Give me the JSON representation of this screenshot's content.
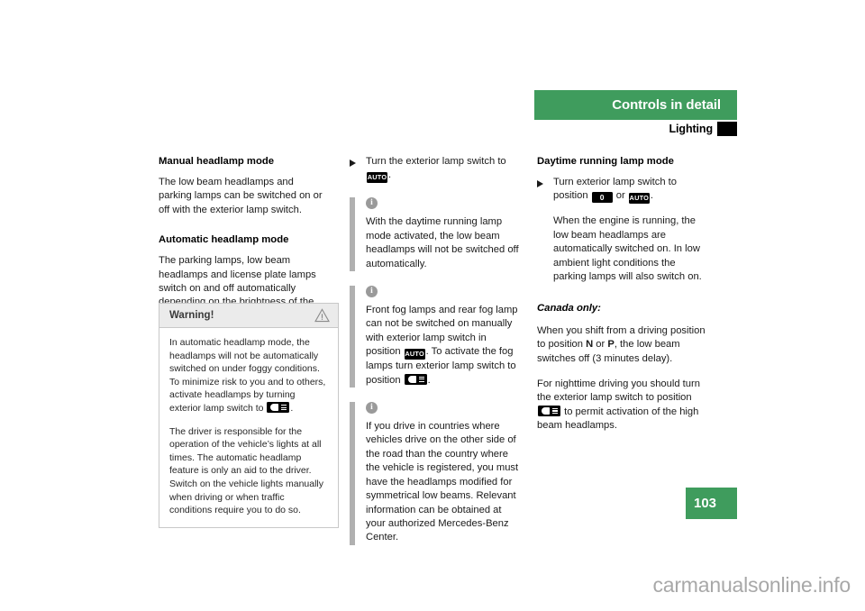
{
  "header": {
    "section_title": "Controls in detail",
    "subsection_title": "Lighting"
  },
  "page_number": "103",
  "watermark": "carmanualsonline.info",
  "symbols": {
    "auto_label": "AUTO",
    "zero_label": "0",
    "lowbeam_name": "low-beam-headlamp-symbol"
  },
  "left_column": {
    "heading1": "Manual headlamp mode",
    "para1": "The low beam headlamps and parking lamps can be switched on or off with the exterior lamp switch.",
    "heading2": "Automatic headlamp mode",
    "para2": "The parking lamps, low beam headlamps and license plate lamps switch on and off automatically depending on the brightness of the ambient light.",
    "warning": {
      "title": "Warning!",
      "body1_a": "In automatic headlamp mode, the headlamps will not be automatically switched on under foggy conditions. To minimize risk to you and to others, activate headlamps by turning exterior lamp switch to ",
      "body1_b": ".",
      "body2": "The driver is responsible for the operation of the vehicle’s lights at all times. The automatic headlamp feature is only an aid to the driver. Switch on the vehicle lights manually when driving or when traffic conditions require you to do so."
    }
  },
  "middle_column": {
    "bullet1_a": "Turn the exterior lamp switch to ",
    "bullet1_b": ".",
    "note1": "With the daytime running lamp mode activated, the low beam headlamps will not be switched off automatically.",
    "note2_a": "Front fog lamps and rear fog lamp can not be switched on manually with exterior lamp switch in position ",
    "note2_b": ". To activate the fog lamps turn exterior lamp switch to position ",
    "note2_c": ".",
    "note3": "If you drive in countries where vehicles drive on the other side of the road than the country where the vehicle is registered, you must have the headlamps modified for symmetrical low beams. Relevant information can be obtained at your authorized Mercedes-Benz Center."
  },
  "right_column": {
    "heading1": "Daytime running lamp mode",
    "bullet1_a": "Turn exterior lamp switch to position ",
    "bullet1_or": " or ",
    "bullet1_b": ".",
    "bullet1_para2": "When the engine is running, the low beam headlamps are automatically switched on. In low ambient light conditions the parking lamps will also switch on.",
    "canada_heading": "Canada only:",
    "canada_para1_a": "When you shift from a driving position to position ",
    "canada_para1_n": "N",
    "canada_para1_or": " or ",
    "canada_para1_p": "P",
    "canada_para1_b": ", the low beam switches off (3 minutes delay).",
    "canada_para2_a": "For nighttime driving you should turn the exterior lamp switch to position ",
    "canada_para2_b": " to permit activation of the high beam headlamps."
  }
}
